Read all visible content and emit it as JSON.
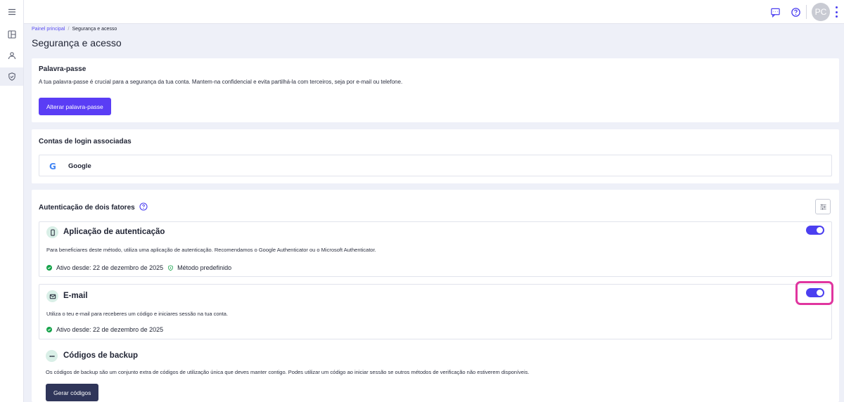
{
  "breadcrumb": {
    "home": "Painel principal",
    "separator": "/",
    "current": "Segurança e acesso"
  },
  "page_title": "Segurança e acesso",
  "topbar": {
    "avatar_initials": "PC",
    "icons": [
      "chat-icon",
      "help-icon",
      "more-vert-icon"
    ]
  },
  "sidebar": {
    "items": [
      "menu-icon",
      "dashboard-icon",
      "user-icon",
      "shield-icon"
    ],
    "active": "shield-icon"
  },
  "password": {
    "title": "Palavra-passe",
    "description": "A tua palavra-passe é crucial para a segurança da tua conta. Mantem-na confidencial e evita partilhá-la com terceiros, seja por e-mail ou telefone.",
    "button": "Alterar palavra-passe"
  },
  "logins": {
    "title": "Contas de login associadas",
    "items": [
      {
        "logo": "G",
        "name": "Google"
      }
    ]
  },
  "twofa": {
    "title": "Autenticação de dois fatores",
    "methods": {
      "app": {
        "title": "Aplicação de autenticação",
        "description": "Para beneficiares deste método, utiliza uma aplicação de autenticação. Recomendamos o Google Authenticator ou o Microsoft Authenticator.",
        "status": "Ativo desde: 22 de dezembro de 2025",
        "default_label": "Método predefinido",
        "enabled": true
      },
      "email": {
        "title": "E-mail",
        "description": "Utiliza o teu e-mail para receberes um código e iniciares sessão na tua conta.",
        "status": "Ativo desde: 22 de dezembro de 2025",
        "enabled": true
      },
      "backup": {
        "title": "Códigos de backup",
        "description": "Os códigos de backup são um conjunto extra de códigos de utilização única que deves manter contigo. Podes utilizar um código ao iniciar sessão se outros métodos de verificação não estiverem disponíveis.",
        "button": "Gerar códigos"
      }
    }
  },
  "colors": {
    "primary": "#5a3df5",
    "toggle_on": "#4b3ff0",
    "success": "#16a34a",
    "highlight": "#e0359f",
    "dark_button": "#2f3559"
  }
}
